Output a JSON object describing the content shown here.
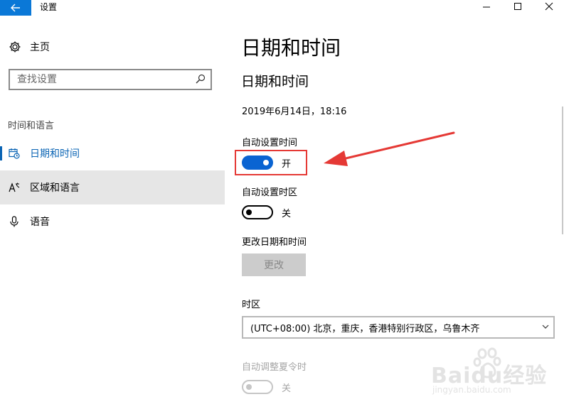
{
  "window": {
    "title": "设置"
  },
  "sidebar": {
    "home_label": "主页",
    "search_placeholder": "查找设置",
    "section_title": "时间和语言",
    "items": [
      {
        "label": "日期和时间",
        "icon": "calendar-clock-icon",
        "state": "selected"
      },
      {
        "label": "区域和语言",
        "icon": "language-icon",
        "state": "hover"
      },
      {
        "label": "语音",
        "icon": "microphone-icon",
        "state": "normal"
      }
    ]
  },
  "main": {
    "page_title": "日期和时间",
    "section_title": "日期和时间",
    "current_datetime": "2019年6月14日，18:16",
    "auto_time": {
      "label": "自动设置时间",
      "state": "开",
      "on": true
    },
    "auto_timezone": {
      "label": "自动设置时区",
      "state": "关",
      "on": false
    },
    "change_datetime": {
      "label": "更改日期和时间",
      "button": "更改"
    },
    "timezone": {
      "label": "时区",
      "value": "(UTC+08:00) 北京，重庆，香港特别行政区，乌鲁木齐"
    },
    "dst": {
      "label": "自动调整夏令时",
      "state": "关",
      "disabled": true
    }
  },
  "watermark": {
    "text": "Baidu经验",
    "url_text": "jingyan.baidu.com"
  },
  "colors": {
    "accent": "#0a64d2",
    "highlight": "#e53935",
    "titlebar_back": "#0a78d7"
  }
}
